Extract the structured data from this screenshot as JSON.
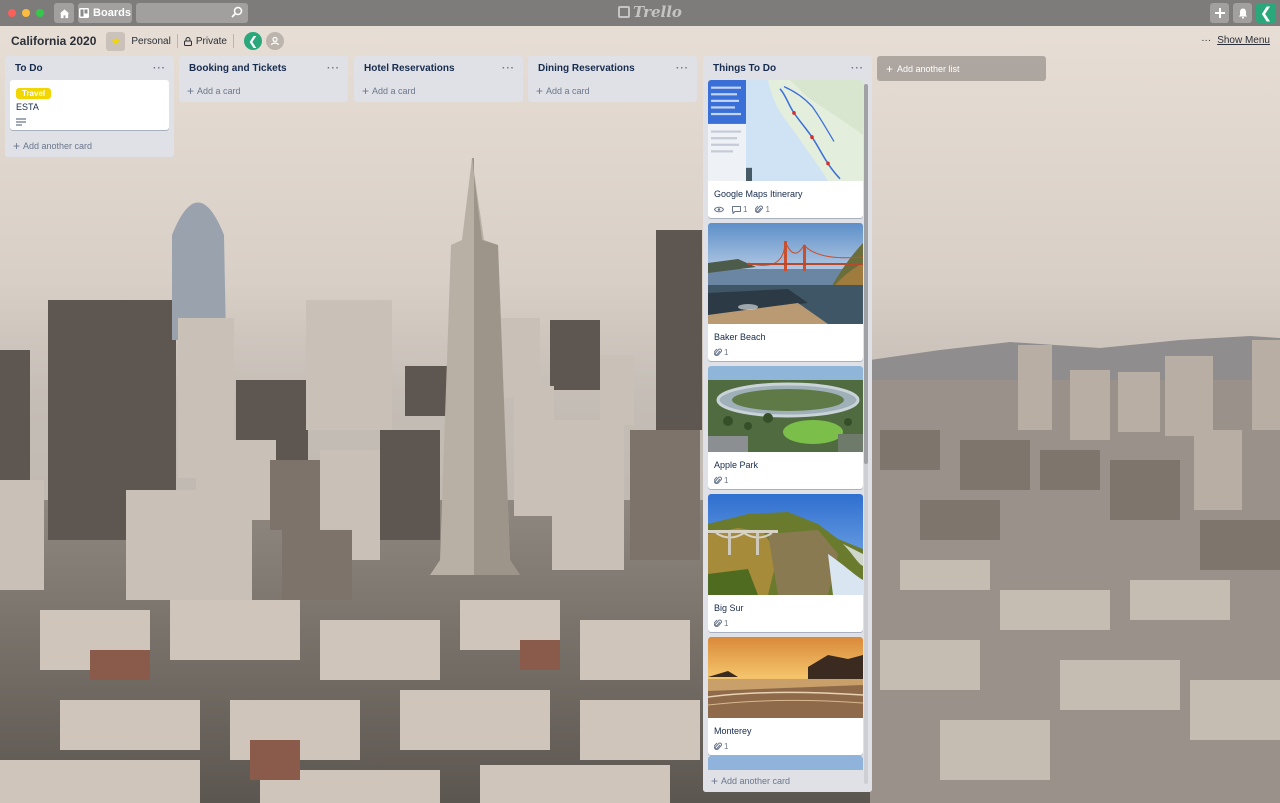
{
  "topbar": {
    "boards_label": "Boards",
    "logo_text": "Trello"
  },
  "board": {
    "title": "California 2020",
    "team": "Personal",
    "visibility": "Private",
    "member_initial": "❮",
    "show_menu_dots": "···",
    "show_menu": "Show Menu"
  },
  "lists": [
    {
      "title": "To Do",
      "menu": "···",
      "cards": [
        {
          "label": "Travel",
          "title": "ESTA",
          "has_description": true
        }
      ],
      "add_label": "Add another card"
    },
    {
      "title": "Booking and Tickets",
      "menu": "···",
      "cards": [],
      "add_label": "Add a card"
    },
    {
      "title": "Hotel Reservations",
      "menu": "···",
      "cards": [],
      "add_label": "Add a card"
    },
    {
      "title": "Dining Reservations",
      "menu": "···",
      "cards": [],
      "add_label": "Add a card"
    },
    {
      "title": "Things To Do",
      "menu": "···",
      "cards": [
        {
          "title": "Google Maps Itinerary",
          "comments": "1",
          "attachments": "1",
          "cover": "map"
        },
        {
          "title": "Baker Beach",
          "attachments": "1",
          "cover": "golden-gate"
        },
        {
          "title": "Apple Park",
          "attachments": "1",
          "cover": "apple-park"
        },
        {
          "title": "Big Sur",
          "attachments": "1",
          "cover": "bixby-bridge"
        },
        {
          "title": "Monterey",
          "attachments": "1",
          "cover": "sunset-beach"
        }
      ],
      "add_label": "Add another card"
    }
  ],
  "add_list_label": "Add another list",
  "colors": {
    "list_bg": "#dfe1e6",
    "label_yellow": "#f2d600",
    "avatar_green": "#2aa87b"
  }
}
